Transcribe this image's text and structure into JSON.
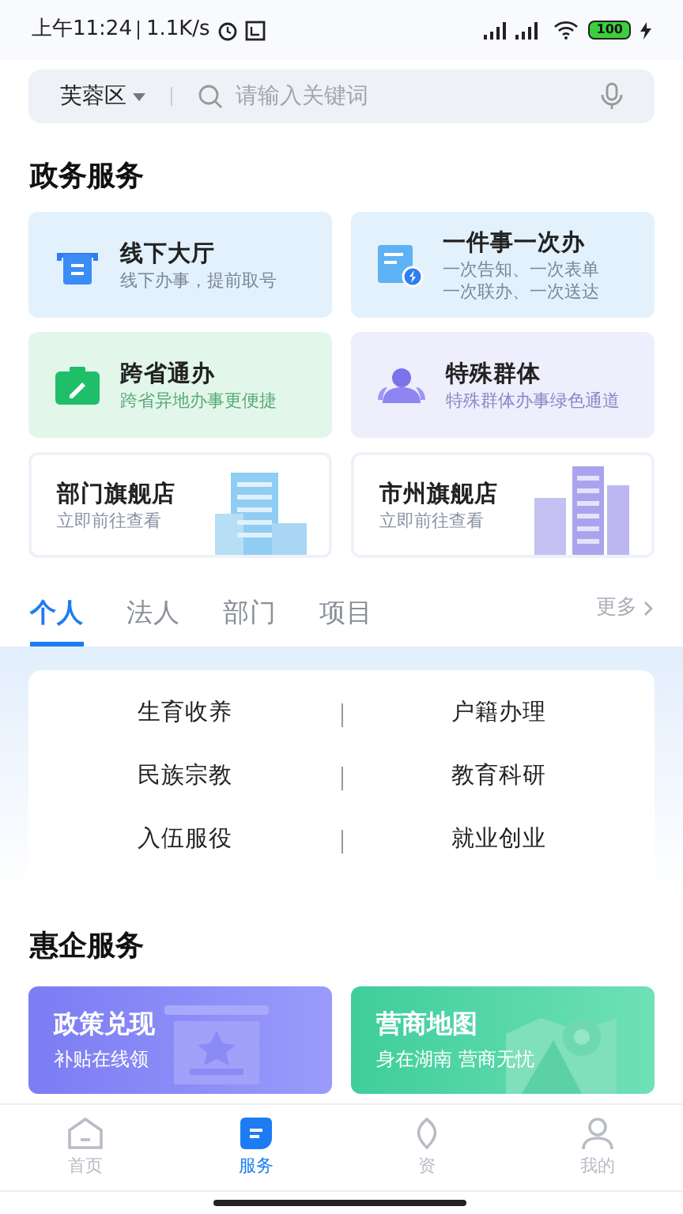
{
  "status_bar": {
    "time": "上午11:24",
    "speed": "1.1K/s",
    "battery": "100"
  },
  "search": {
    "district": "芙蓉区",
    "placeholder": "请输入关键词"
  },
  "gov_section": {
    "title": "政务服务",
    "cards": [
      {
        "kind": "counter",
        "title": "线下大厅",
        "lines": [
          "线下办事，提前取号"
        ]
      },
      {
        "kind": "doc",
        "title": "一件事一次办",
        "lines": [
          "一次告知、一次表单",
          "一次联办、一次送达"
        ]
      },
      {
        "kind": "cross",
        "title": "跨省通办",
        "lines": [
          "跨省异地办事更便捷"
        ]
      },
      {
        "kind": "group",
        "title": "特殊群体",
        "lines": [
          "特殊群体办事绿色通道"
        ]
      },
      {
        "kind": "dept",
        "title": "部门旗舰店",
        "lines": [
          "立即前往查看"
        ]
      },
      {
        "kind": "city",
        "title": "市州旗舰店",
        "lines": [
          "立即前往查看"
        ]
      }
    ]
  },
  "tabs": [
    {
      "label": "个人",
      "selected": true
    },
    {
      "label": "法人",
      "selected": false
    },
    {
      "label": "部门",
      "selected": false
    },
    {
      "label": "项目",
      "selected": false
    }
  ],
  "more": "更多",
  "categories": [
    "生育收养",
    "户籍办理",
    "民族宗教",
    "教育科研",
    "入伍服役",
    "就业创业"
  ],
  "biz_section": {
    "title": "惠企服务",
    "cards": [
      {
        "kind": "policy",
        "title": "政策兑现",
        "subtitle": "补贴在线领"
      },
      {
        "kind": "map",
        "title": "营商地图",
        "subtitle": "身在湖南 营商无忧"
      }
    ]
  },
  "bottom_nav": [
    {
      "label": "首页",
      "selected": false
    },
    {
      "label": "服务",
      "selected": true
    },
    {
      "label": "资",
      "selected": false
    },
    {
      "label": "我的",
      "selected": false
    }
  ]
}
